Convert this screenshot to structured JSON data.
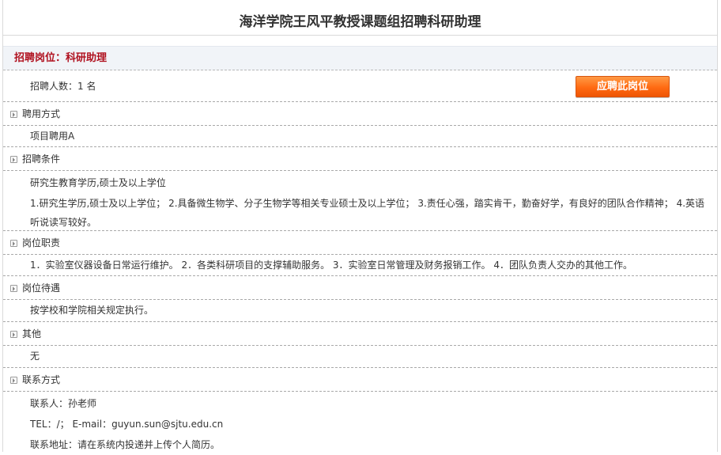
{
  "page_title": "海洋学院王风平教授课题组招聘科研助理",
  "post": {
    "label": "招聘岗位：科研助理"
  },
  "count": {
    "text": "招聘人数：1 名"
  },
  "apply_button": "应聘此岗位",
  "sections": {
    "employment": {
      "title": "聘用方式",
      "lines": [
        "项目聘用A"
      ]
    },
    "conditions": {
      "title": "招聘条件",
      "lines": [
        "研究生教育学历,硕士及以上学位",
        "1.研究生学历,硕士及以上学位； 2.具备微生物学、分子生物学等相关专业硕士及以上学位； 3.责任心强，踏实肯干，勤奋好学，有良好的团队合作精神； 4.英语听说读写较好。"
      ]
    },
    "duties": {
      "title": "岗位职责",
      "lines": [
        "1．实验室仪器设备日常运行维护。 2．各类科研项目的支撑辅助服务。 3．实验室日常管理及财务报销工作。 4．团队负责人交办的其他工作。"
      ]
    },
    "benefits": {
      "title": "岗位待遇",
      "lines": [
        "按学校和学院相关规定执行。"
      ]
    },
    "other": {
      "title": "其他",
      "lines": [
        "无"
      ]
    },
    "contact": {
      "title": "联系方式",
      "lines": [
        "联系人：孙老师",
        "TEL：/；  E-mail：guyun.sun@sjtu.edu.cn",
        "联系地址：请在系统内投递并上传个人简历。"
      ]
    }
  }
}
